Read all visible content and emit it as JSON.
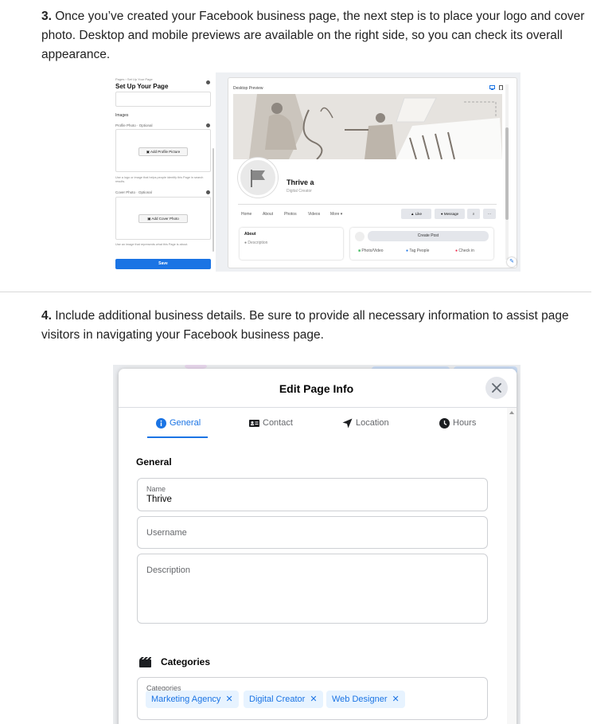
{
  "step3": {
    "number": "3.",
    "text": " Once you’ve created your Facebook business page, the next step is to place your logo and cover photo. Desktop and mobile previews are available on the right side, so you can check its overall appearance."
  },
  "step4": {
    "number": "4.",
    "text": " Include additional business details. Be sure to provide all necessary information to assist page visitors in navigating your Facebook business page."
  },
  "setup": {
    "breadcrumb": "Pages › Set Up Your Page",
    "title": "Set Up Your Page",
    "images_label": "Images",
    "profile_photo_label": "Profile Photo · Optional",
    "add_profile_button": "Add Profile Picture",
    "profile_help": "Use a logo or image that helps people identify this Page in search results.",
    "cover_photo_label": "Cover Photo · Optional",
    "add_cover_button": "Add Cover Photo",
    "cover_help": "Use an image that represents what this Page is about.",
    "save_button": "Save"
  },
  "preview": {
    "title": "Desktop Preview",
    "page_name": "Thrive a",
    "page_category": "Digital Creator",
    "nav": [
      "Home",
      "About",
      "Photos",
      "Videos",
      "More ▾"
    ],
    "like_button": "Like",
    "message_button": "Message",
    "about_title": "About",
    "about_item": "Description",
    "create_post": "Create Post",
    "photo_video": "Photo/Video",
    "tag_people": "Tag People",
    "check_in": "Check in"
  },
  "dialog": {
    "title": "Edit Page Info",
    "tabs": [
      {
        "label": "General",
        "icon": "info-icon"
      },
      {
        "label": "Contact",
        "icon": "contact-card-icon"
      },
      {
        "label": "Location",
        "icon": "location-arrow-icon"
      },
      {
        "label": "Hours",
        "icon": "clock-icon"
      }
    ],
    "section_title": "General",
    "name_label": "Name",
    "name_value": "Thrive",
    "username_placeholder": "Username",
    "description_placeholder": "Description",
    "categories_title": "Categories",
    "categories_label": "Categories",
    "categories": [
      "Marketing Agency",
      "Digital Creator",
      "Web Designer"
    ],
    "chip_remove": "✕"
  },
  "colors": {
    "facebook_blue": "#1b74e4",
    "chip_bg": "#e7f3ff"
  }
}
